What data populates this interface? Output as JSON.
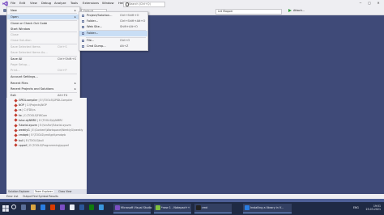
{
  "menubar": {
    "items": [
      "File",
      "Edit",
      "View",
      "Debug",
      "Analyze",
      "Tools",
      "Extensions",
      "Window",
      "Help"
    ],
    "search_placeholder": "Search (Ctrl+Q)"
  },
  "toolbar": {
    "config_dropdown": "Default",
    "platform_dropdown": "Let Mapper",
    "attach_label": "Attach..."
  },
  "file_menu": {
    "items": [
      {
        "label": "New",
        "shortcut": "",
        "arrow": "▸",
        "disabled": false
      },
      {
        "label": "Open",
        "shortcut": "",
        "arrow": "▸",
        "disabled": false,
        "highlighted": true
      },
      {
        "label": "Clone or Check Out Code",
        "shortcut": "",
        "arrow": "",
        "disabled": false
      },
      {
        "label": "Start Window",
        "shortcut": "",
        "arrow": "",
        "disabled": false
      },
      {
        "label": "Close",
        "shortcut": "",
        "arrow": "",
        "disabled": true
      },
      {
        "label": "Close Solution",
        "shortcut": "",
        "arrow": "",
        "disabled": true
      },
      {
        "label": "Save Selected Items",
        "shortcut": "Ctrl+S",
        "arrow": "",
        "disabled": true
      },
      {
        "label": "Save Selected Items As...",
        "shortcut": "",
        "arrow": "",
        "disabled": true
      },
      {
        "label": "Save All",
        "shortcut": "Ctrl+Shift+S",
        "arrow": "",
        "disabled": false
      },
      {
        "label": "Page Setup...",
        "shortcut": "",
        "arrow": "",
        "disabled": true
      },
      {
        "label": "Print...",
        "shortcut": "Ctrl+P",
        "arrow": "",
        "disabled": true
      },
      {
        "label": "Account Settings...",
        "shortcut": "",
        "arrow": "",
        "disabled": false
      },
      {
        "label": "Recent Files",
        "shortcut": "",
        "arrow": "▸",
        "disabled": false
      },
      {
        "label": "Recent Projects and Solutions",
        "shortcut": "",
        "arrow": "▸",
        "disabled": false
      },
      {
        "label": "Exit",
        "shortcut": "Alt+F4",
        "arrow": "",
        "disabled": false
      }
    ]
  },
  "open_menu": {
    "items": [
      {
        "label": "Project/Solution...",
        "shortcut": "Ctrl+Shift+O"
      },
      {
        "label": "Folder...",
        "shortcut": "Ctrl+Shift+Alt+O"
      },
      {
        "label": "Web Site...",
        "shortcut": "Shift+Alt+O"
      },
      {
        "label": "Folder...",
        "shortcut": "",
        "highlighted": true
      },
      {
        "label": "File...",
        "shortcut": "Ctrl+O"
      },
      {
        "label": "Cmd Dump...",
        "shortcut": "Alt+Z"
      }
    ]
  },
  "recent_projects": [
    {
      "name": "GPIDLcompiler",
      "path": "E:\\TOOLS\\GPIDLCompiler"
    },
    {
      "name": "NOP",
      "path": "C:\\Projects\\NOP"
    },
    {
      "name": "cs",
      "path": "C:\\FDI\\cs"
    },
    {
      "name": "fw",
      "path": "C:\\TOOLS\\FWCom"
    },
    {
      "name": "tutor-dyNMRC",
      "path": "E:\\TOOLS\\dyNMRC"
    },
    {
      "name": "Tutorial.sysvm",
      "path": "E:\\VcsFor\\Tutorial.sysvm"
    },
    {
      "name": "weeklyG",
      "path": "E:\\Content\\Workspace\\WeeklyG\\weekly"
    },
    {
      "name": "cmdqrb",
      "path": "E:\\TOOLS\\cmd\\qrb\\cmdqrb"
    },
    {
      "name": "bull",
      "path": "E:\\TOOLS\\bull"
    },
    {
      "name": "cppref",
      "path": "E:\\TOOLS\\Programming\\cppref"
    }
  ],
  "panel_tabs": [
    "Solution Explorer",
    "Team Explorer",
    "Class View"
  ],
  "output_tabs": [
    "Error List",
    "Output",
    "Find Symbol Results"
  ],
  "taskbar": {
    "windows": [
      {
        "label": "Microsoft Visual Studio"
      },
      {
        "label": "*new 1 - Notepad++"
      },
      {
        "label": "cmd"
      },
      {
        "label": "Installing a library in V..."
      }
    ],
    "lang": "ENG",
    "time": "19:51",
    "date": "23-03-2021"
  },
  "colors": {
    "background": "#3f4a78",
    "menu_highlight": "#c9def5",
    "taskbar": "#1f2a44",
    "statusbar": "#4d5f96"
  }
}
